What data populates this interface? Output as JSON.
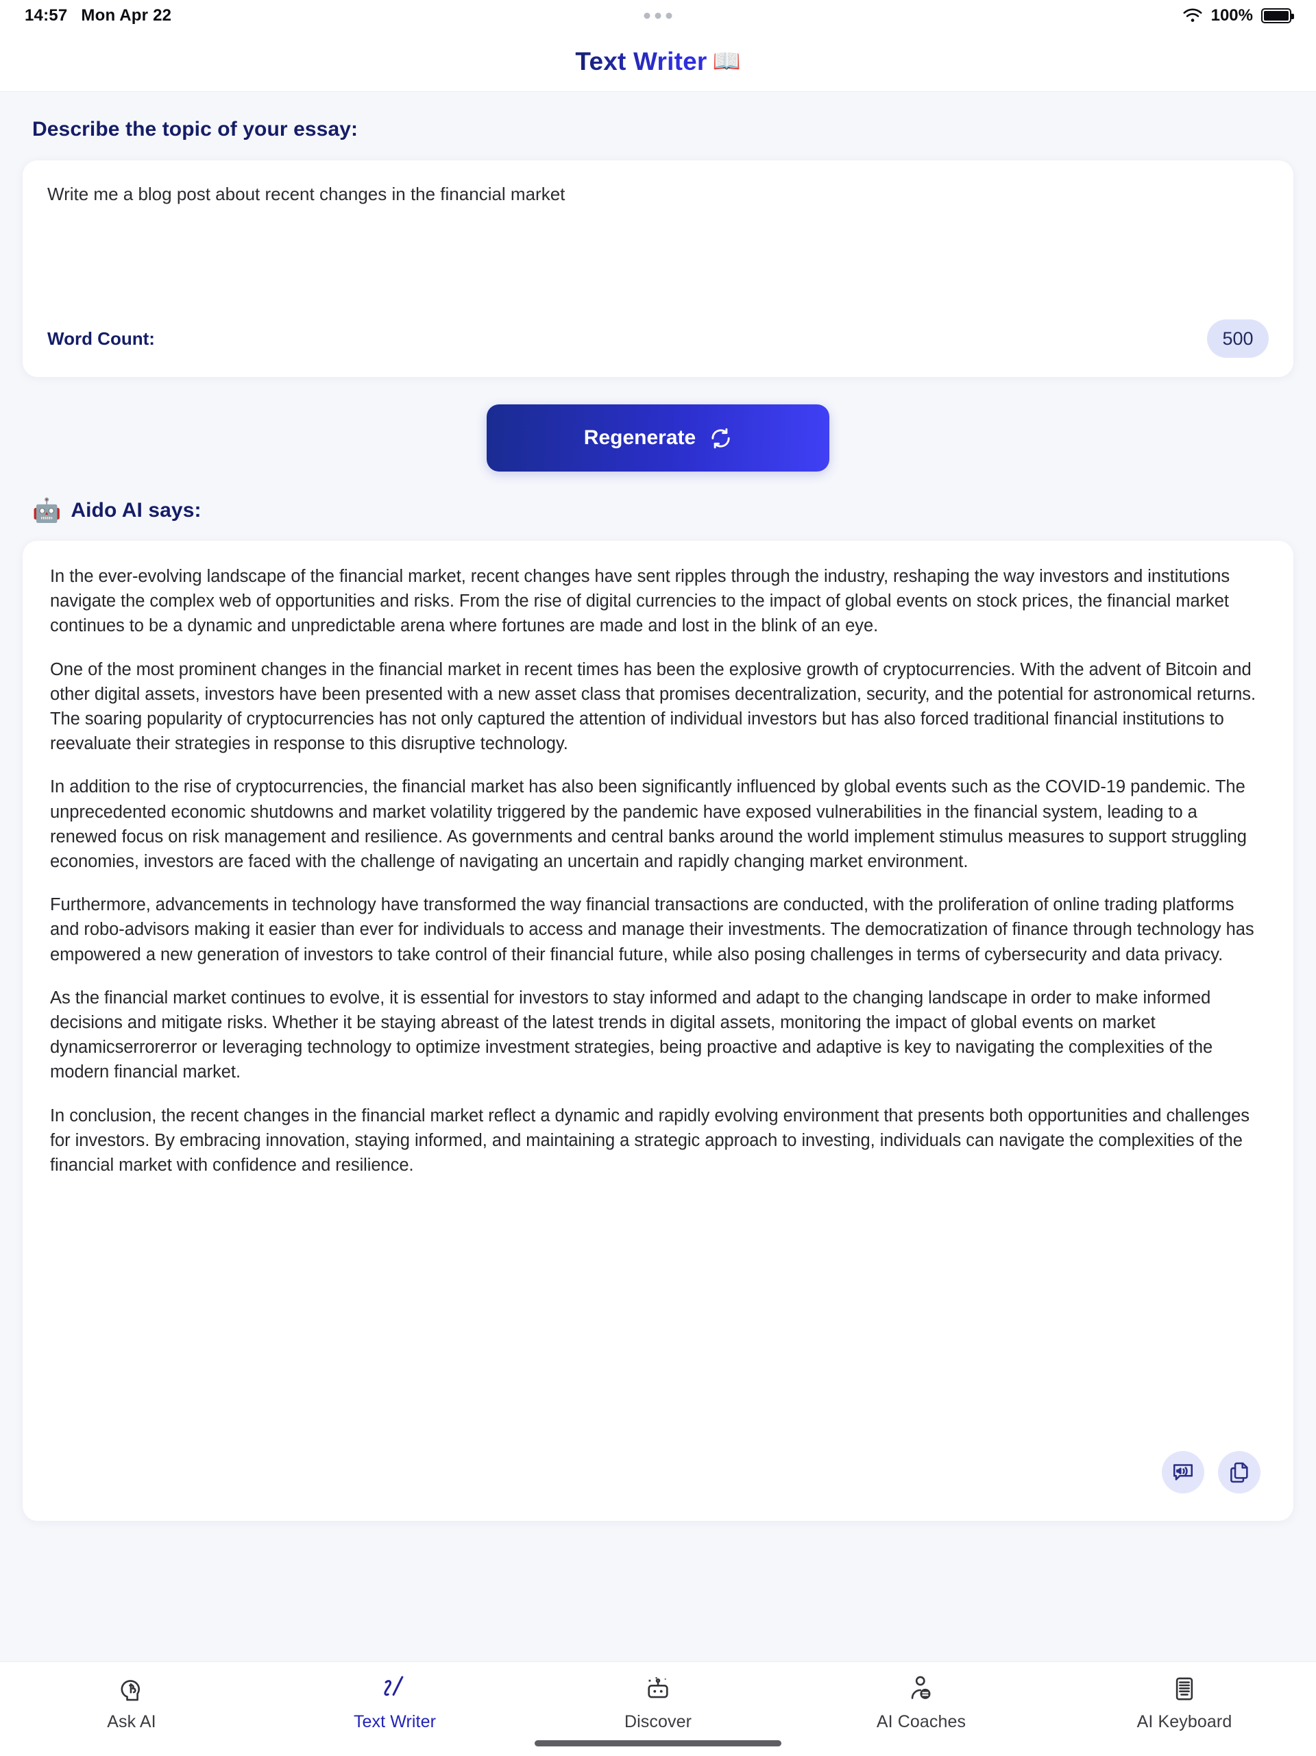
{
  "status_bar": {
    "time": "14:57",
    "date": "Mon Apr 22",
    "battery_percent": "100%",
    "wifi_icon": "wifi-icon",
    "battery_icon": "battery-full-icon"
  },
  "header": {
    "title": "Text Writer",
    "title_emoji": "📖",
    "title_color": "#2323b8"
  },
  "prompt": {
    "section_label": "Describe the topic of your essay:",
    "value": "Write me a blog post about recent changes in the financial market",
    "placeholder": "Describe the topic of your essay...",
    "word_count_label": "Word Count:",
    "word_count_value": "500",
    "badge_bg": "#dfe3fa"
  },
  "regenerate": {
    "label": "Regenerate",
    "icon": "refresh-icon",
    "gradient_from": "#1a2c92",
    "gradient_to": "#4040f5"
  },
  "output": {
    "header_emoji": "🤖",
    "header_label": "Aido AI says:",
    "paragraphs": [
      "In the ever-evolving landscape of the financial market, recent changes have sent ripples through the industry, reshaping the way investors and institutions navigate the complex web of opportunities and risks. From the rise of digital currencies to the impact of global events on stock prices, the financial market continues to be a dynamic and unpredictable arena where fortunes are made and lost in the blink of an eye.",
      "One of the most prominent changes in the financial market in recent times has been the explosive growth of cryptocurrencies. With the advent of Bitcoin and other digital assets, investors have been presented with a new asset class that promises decentralization, security, and the potential for astronomical returns. The soaring popularity of cryptocurrencies has not only captured the attention of individual investors but has also forced traditional financial institutions to reevaluate their strategies in response to this disruptive technology.",
      "In addition to the rise of cryptocurrencies, the financial market has also been significantly influenced by global events such as the COVID-19 pandemic. The unprecedented economic shutdowns and market volatility triggered by the pandemic have exposed vulnerabilities in the financial system, leading to a renewed focus on risk management and resilience. As governments and central banks around the world implement stimulus measures to support struggling economies, investors are faced with the challenge of navigating an uncertain and rapidly changing market environment.",
      "Furthermore, advancements in technology have transformed the way financial transactions are conducted, with the proliferation of online trading platforms and robo-advisors making it easier than ever for individuals to access and manage their investments. The democratization of finance through technology has empowered a new generation of investors to take control of their financial future, while also posing challenges in terms of cybersecurity and data privacy.",
      "As the financial market continues to evolve, it is essential for investors to stay informed and adapt to the changing landscape in order to make informed decisions and mitigate risks. Whether it be staying abreast of the latest trends in digital assets, monitoring the impact of global events on market dynamicserrorerror or leveraging technology to optimize investment strategies, being proactive and adaptive is key to navigating the complexities of the modern financial market.",
      "In conclusion, the recent changes in the financial market reflect a dynamic and rapidly evolving environment that presents both opportunities and challenges for investors. By embracing innovation, staying informed, and maintaining a strategic approach to investing, individuals can navigate the complexities of the financial market with confidence and resilience."
    ],
    "actions": [
      {
        "name": "speak-icon"
      },
      {
        "name": "copy-icon"
      }
    ]
  },
  "tabbar": {
    "active_color": "#2323b8",
    "inactive_color": "#3b3b41",
    "items": [
      {
        "label": "Ask AI",
        "icon": "brain-head-icon",
        "active": false
      },
      {
        "label": "Text Writer",
        "icon": "pen-signature-icon",
        "active": true
      },
      {
        "label": "Discover",
        "icon": "robot-sparkle-icon",
        "active": false
      },
      {
        "label": "AI Coaches",
        "icon": "person-chat-icon",
        "active": false
      },
      {
        "label": "AI Keyboard",
        "icon": "keyboard-icon",
        "active": false
      }
    ]
  }
}
